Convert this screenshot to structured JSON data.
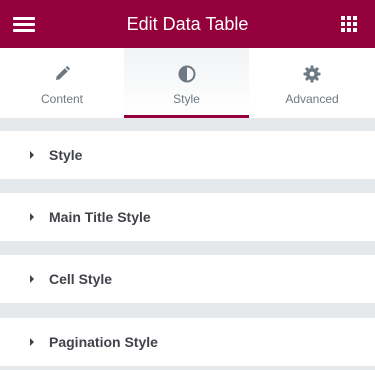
{
  "header": {
    "title": "Edit Data Table",
    "menu_icon": "hamburger-menu-icon",
    "grid_icon": "apps-grid-icon",
    "background": "#93003c"
  },
  "tabs": [
    {
      "label": "Content",
      "icon": "pencil-icon",
      "active": false
    },
    {
      "label": "Style",
      "icon": "half-circle-contrast-icon",
      "active": true
    },
    {
      "label": "Advanced",
      "icon": "gear-icon",
      "active": false
    }
  ],
  "sections": [
    {
      "label": "Style",
      "icon": "caret-right-icon"
    },
    {
      "label": "Main Title Style",
      "icon": "caret-right-icon"
    },
    {
      "label": "Cell Style",
      "icon": "caret-right-icon"
    },
    {
      "label": "Pagination Style",
      "icon": "caret-right-icon"
    }
  ],
  "colors": {
    "accent": "#93003c",
    "panel_bg": "#e6e9ec",
    "text_dark": "#404349",
    "text_muted": "#6d7882"
  }
}
